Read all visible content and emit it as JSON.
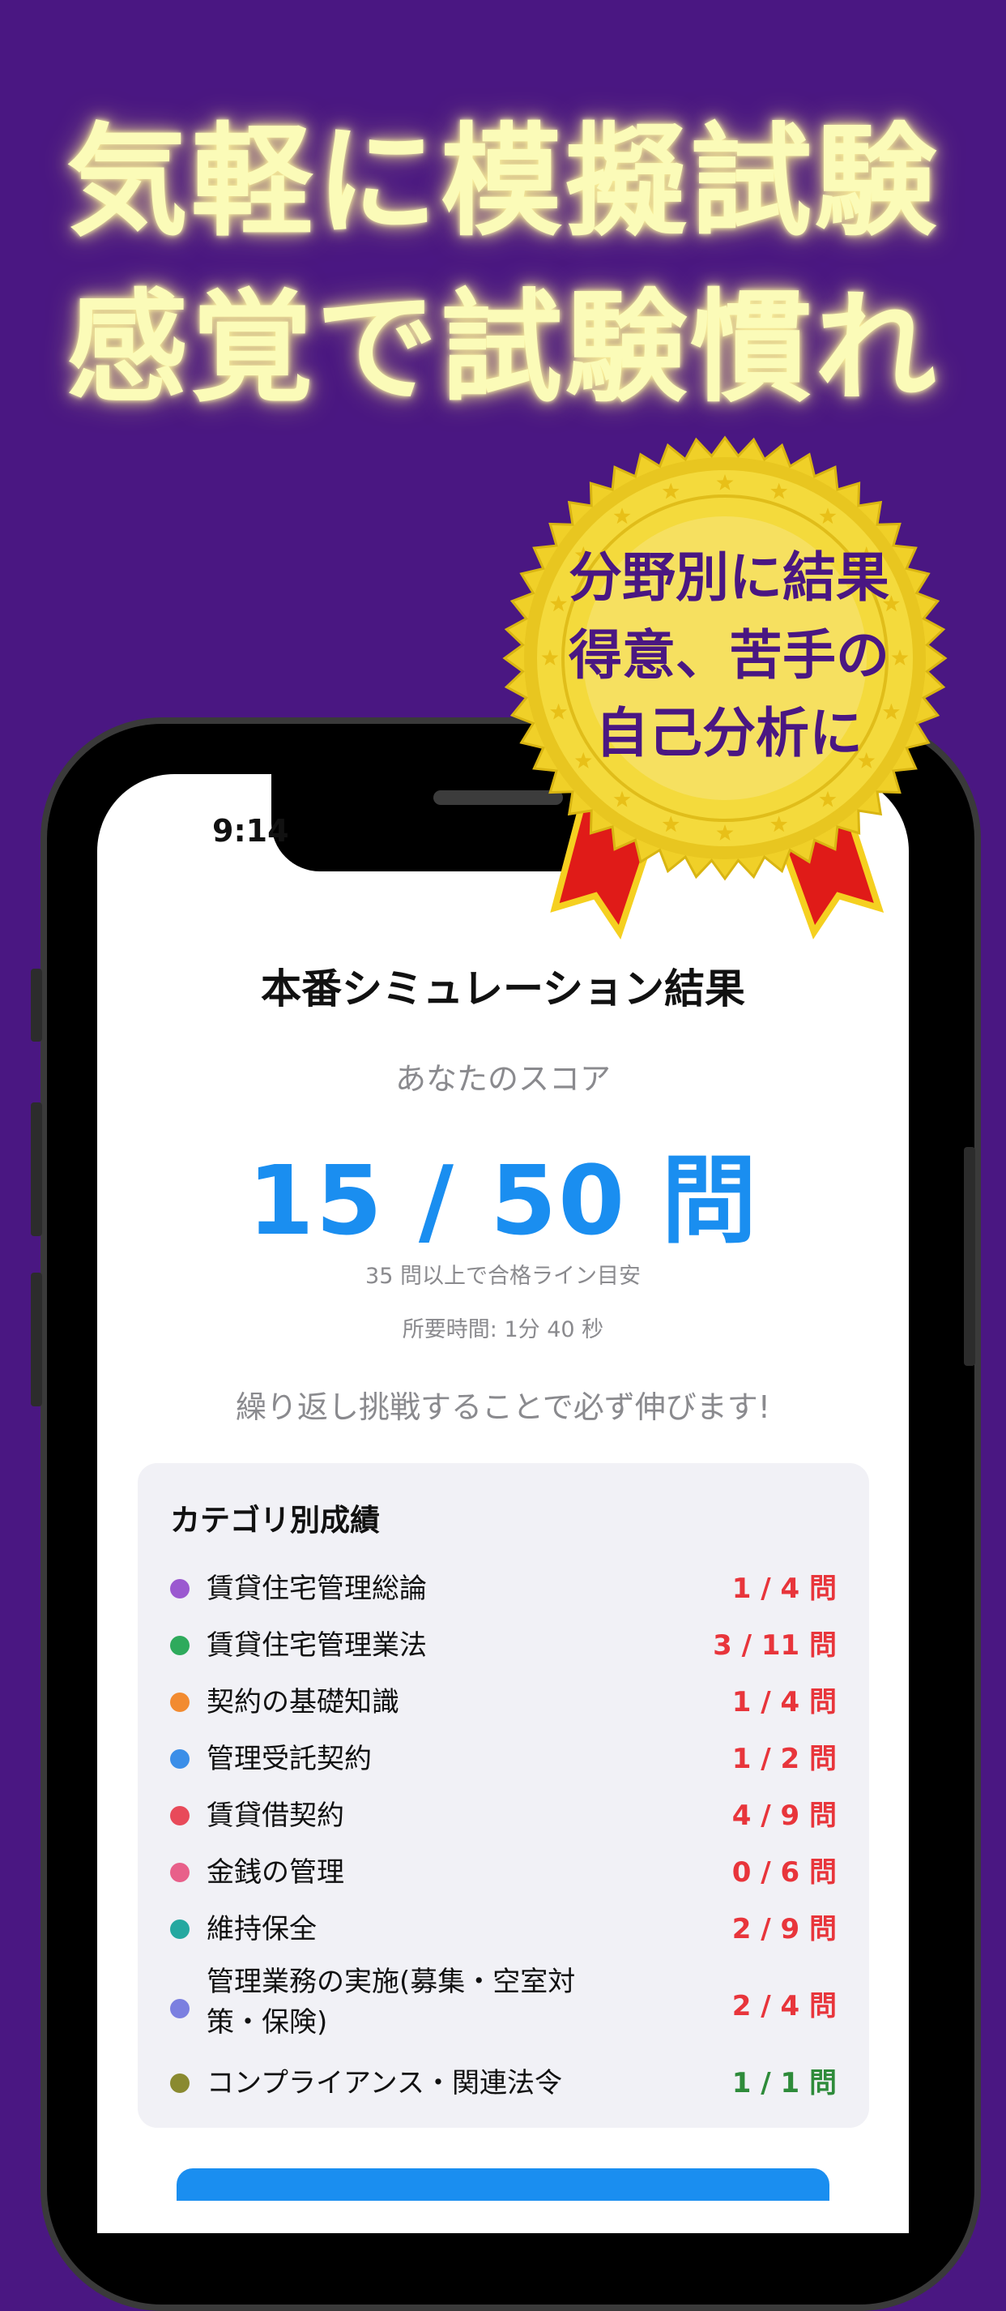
{
  "headline": {
    "line1": "気軽に模擬試験",
    "line2": "感覚で試験慣れ"
  },
  "badge": {
    "line1": "分野別に結果",
    "line2": "得意、苦手の",
    "line3": "自己分析に"
  },
  "status_bar": {
    "time": "9:14"
  },
  "result": {
    "title": "本番シミュレーション結果",
    "score_label": "あなたのスコア",
    "score": "15 / 50 問",
    "pass_line": "35 問以上で合格ライン目安",
    "elapsed": "所要時間: 1分 40 秒",
    "encourage": "繰り返し挑戦することで必ず伸びます!"
  },
  "categories": {
    "title": "カテゴリ別成績",
    "items": [
      {
        "name": "賃貸住宅管理総論",
        "score": "1 / 4 問",
        "dot_color": "#9b59d0",
        "score_color": "#e8353b"
      },
      {
        "name": "賃貸住宅管理業法",
        "score": "3 / 11 問",
        "dot_color": "#2eaa5c",
        "score_color": "#e8353b"
      },
      {
        "name": "契約の基礎知識",
        "score": "1 / 4 問",
        "dot_color": "#f28b30",
        "score_color": "#e8353b"
      },
      {
        "name": "管理受託契約",
        "score": "1 / 2 問",
        "dot_color": "#3b8ee8",
        "score_color": "#e8353b"
      },
      {
        "name": "賃貸借契約",
        "score": "4 / 9 問",
        "dot_color": "#e84a5a",
        "score_color": "#e8353b"
      },
      {
        "name": "金銭の管理",
        "score": "0 / 6 問",
        "dot_color": "#e8608a",
        "score_color": "#e8353b"
      },
      {
        "name": "維持保全",
        "score": "2 / 9 問",
        "dot_color": "#25a8a0",
        "score_color": "#e8353b"
      },
      {
        "name": "管理業務の実施(募集・空室対策・保険)",
        "score": "2 / 4 問",
        "dot_color": "#7b7fe0",
        "score_color": "#e8353b"
      },
      {
        "name": "コンプライアンス・関連法令",
        "score": "1 / 1 問",
        "dot_color": "#8a8a30",
        "score_color": "#2e8b3a"
      }
    ]
  }
}
